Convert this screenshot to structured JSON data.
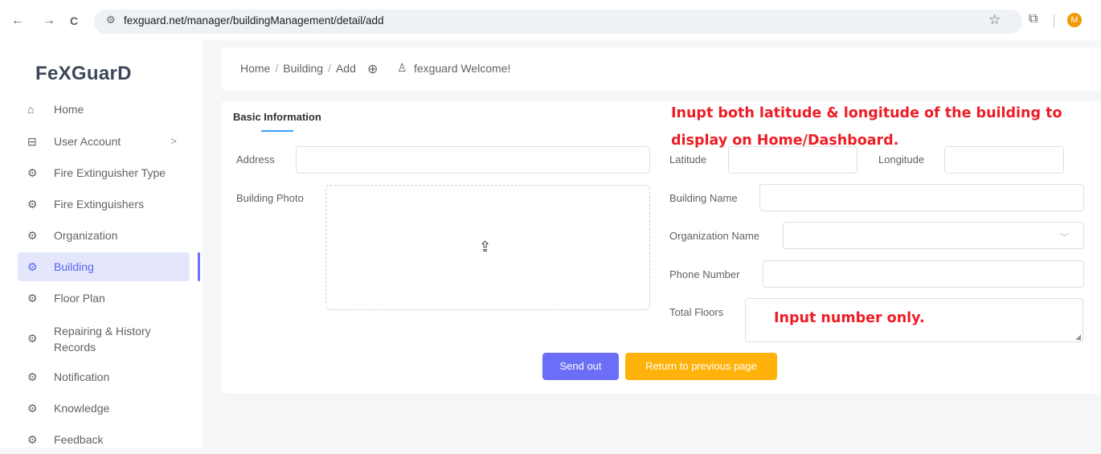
{
  "browser": {
    "back": "←",
    "forward": "→",
    "reload": "C",
    "url": "fexguard.net/manager/buildingManagement/detail/add",
    "avatar_letter": "M"
  },
  "sidebar": {
    "logo": "FeXGuarD",
    "items": [
      {
        "label": "Home",
        "icon": "home-icon"
      },
      {
        "label": "User Account",
        "icon": "table-icon",
        "arrow": ">"
      },
      {
        "label": "Fire Extinguisher Type",
        "icon": "gear-icon"
      },
      {
        "label": "Fire Extinguishers",
        "icon": "gear-icon"
      },
      {
        "label": "Organization",
        "icon": "gear-icon"
      },
      {
        "label": "Building",
        "icon": "gear-icon",
        "active": true
      },
      {
        "label": "Floor Plan",
        "icon": "gear-icon"
      },
      {
        "label": "Repairing & History Records",
        "icon": "gear-icon"
      },
      {
        "label": "Notification",
        "icon": "gear-icon"
      },
      {
        "label": "Knowledge",
        "icon": "gear-icon"
      },
      {
        "label": "Feedback",
        "icon": "gear-icon"
      }
    ]
  },
  "header": {
    "breadcrumb": [
      "Home",
      "Building",
      "Add"
    ],
    "welcome": "fexguard Welcome!"
  },
  "form": {
    "tab": "Basic Information",
    "address_label": "Address",
    "photo_label": "Building Photo",
    "latitude_label": "Latitude",
    "longitude_label": "Longitude",
    "building_name_label": "Building Name",
    "organization_label": "Organization Name",
    "phone_label": "Phone Number",
    "floors_label": "Total Floors",
    "send_button": "Send out",
    "return_button": "Return to previous page"
  },
  "annotations": {
    "latlng_note": "Inupt both latitude & longitude of the building to display on Home/Dashboard.",
    "floors_note": "Input number only."
  },
  "colors": {
    "accent": "#6b6ff7",
    "warning": "#ffb20a",
    "annotation": "#ee1c25",
    "active_bg": "#e4e7fb"
  }
}
